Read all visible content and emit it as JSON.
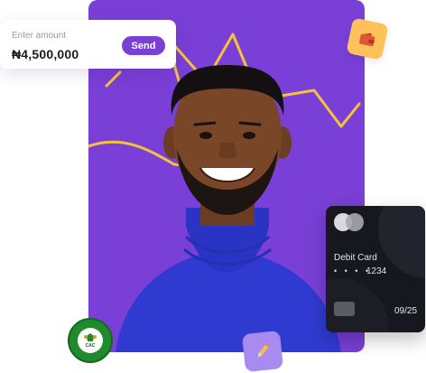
{
  "amount_card": {
    "label": "Enter amount",
    "value": "₦4,500,000",
    "send_label": "Send"
  },
  "debit_card": {
    "title": "Debit Card",
    "masked": "• • • •",
    "last4": "1234",
    "expiry": "09/25"
  },
  "seal": {
    "text": "CAC",
    "ring_text": "CORPORATE AFFAIRS COMMISSION"
  },
  "colors": {
    "brand_purple": "#7a3fd6",
    "wave_yellow": "#f3c43a",
    "wallet_badge": "#ffc25a",
    "pencil_badge": "#a98af0",
    "card_bg": "#17181f"
  },
  "icons": {
    "wallet": "wallet-icon",
    "pencil": "pencil-icon",
    "card_brand": "card-brand-icon"
  }
}
